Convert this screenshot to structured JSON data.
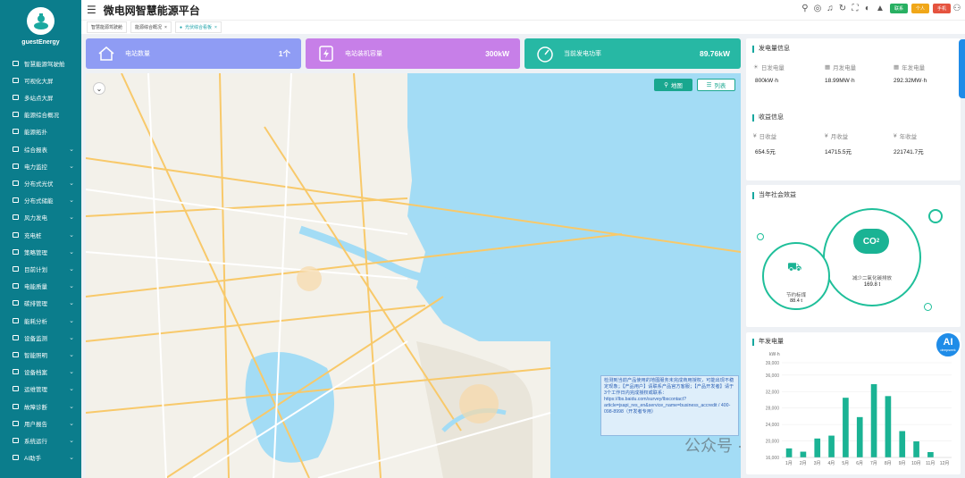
{
  "app": {
    "user": "guestEnergy",
    "title": "微电网智慧能源平台"
  },
  "tabs": [
    "智慧能源驾驶舱",
    "能源综合概况",
    "光伏综合看板"
  ],
  "nav": [
    {
      "label": "智慧能源驾驶舱",
      "caret": false
    },
    {
      "label": "可视化大屏",
      "caret": false
    },
    {
      "label": "多站点大屏",
      "caret": false
    },
    {
      "label": "能源综合概况",
      "caret": false
    },
    {
      "label": "能源拓扑",
      "caret": false
    },
    {
      "label": "综合报表",
      "caret": true
    },
    {
      "label": "电力监控",
      "caret": true
    },
    {
      "label": "分布式光伏",
      "caret": true
    },
    {
      "label": "分布式储能",
      "caret": true
    },
    {
      "label": "风力发电",
      "caret": true
    },
    {
      "label": "充电桩",
      "caret": true
    },
    {
      "label": "策略管理",
      "caret": true
    },
    {
      "label": "目前计划",
      "caret": true
    },
    {
      "label": "电能质量",
      "caret": true
    },
    {
      "label": "碳排管理",
      "caret": true
    },
    {
      "label": "能耗分析",
      "caret": true
    },
    {
      "label": "设备监测",
      "caret": true
    },
    {
      "label": "智能照明",
      "caret": true
    },
    {
      "label": "设备档案",
      "caret": true
    },
    {
      "label": "运维管理",
      "caret": true
    },
    {
      "label": "故障诊断",
      "caret": true
    },
    {
      "label": "用户报告",
      "caret": true
    },
    {
      "label": "系统运行",
      "caret": true
    },
    {
      "label": "AI助手",
      "caret": true
    }
  ],
  "toolbar": {
    "badges": [
      "联系",
      "个人",
      "手机"
    ]
  },
  "stats": [
    {
      "label": "电站数量",
      "value": "1个",
      "color": "#8f9cf4"
    },
    {
      "label": "电站装机容量",
      "value": "300kW",
      "color": "#c77fe8"
    },
    {
      "label": "当前发电功率",
      "value": "89.76kW",
      "color": "#27b8a4"
    }
  ],
  "map": {
    "btn_map": "地图",
    "btn_list": "列表",
    "notice": "检测到当前产品使用的地图服务未完成商用授权，可能出现不稳定现象；【产品用户】请联系产品官方客服；【产品开发者】请于3个工作日内完成授权或联系：https://lbs.baidu.com/survey/lbscontact?article=jsapi_res_en&service_name=business_accredit / 400-098-8998（开发者专用）",
    "watermark": "公众号 · 零碳微观",
    "ai_badge": "AI",
    "ai_sub": "deepseek"
  },
  "generation": {
    "title": "发电量信息",
    "items": [
      {
        "label": "日发电量",
        "value": "800kW·h"
      },
      {
        "label": "月发电量",
        "value": "18.99MW·h"
      },
      {
        "label": "年发电量",
        "value": "292.32MW·h"
      }
    ]
  },
  "income": {
    "title": "收益信息",
    "items": [
      {
        "label": "日收益",
        "value": "654.5元"
      },
      {
        "label": "月收益",
        "value": "14715.5元"
      },
      {
        "label": "年收益",
        "value": "221741.7元"
      }
    ]
  },
  "social": {
    "title": "当年社会效益",
    "co2_label": "减少二氧化碳排放",
    "co2_value": "169.8 t",
    "coal_label": "节约标煤",
    "coal_value": "88.4 t"
  },
  "chart_data": {
    "type": "bar",
    "title": "年发电量",
    "ylabel": "kW·h",
    "ylim": [
      16000,
      39000
    ],
    "yticks": [
      "16,000",
      "18,000",
      "20,000",
      "22,000",
      "24,000",
      "26,000",
      "28,000",
      "30,000",
      "32,000",
      "34,000",
      "36,000",
      "38,000",
      "39,000"
    ],
    "categories": [
      "1月",
      "2月",
      "3月",
      "4月",
      "5月",
      "6月",
      "7月",
      "8月",
      "9月",
      "10月",
      "11月",
      "12月"
    ],
    "values": [
      18200,
      17400,
      20600,
      21300,
      30500,
      25800,
      33800,
      30900,
      22400,
      19900,
      17300,
      0
    ],
    "color": "#1ab394"
  }
}
